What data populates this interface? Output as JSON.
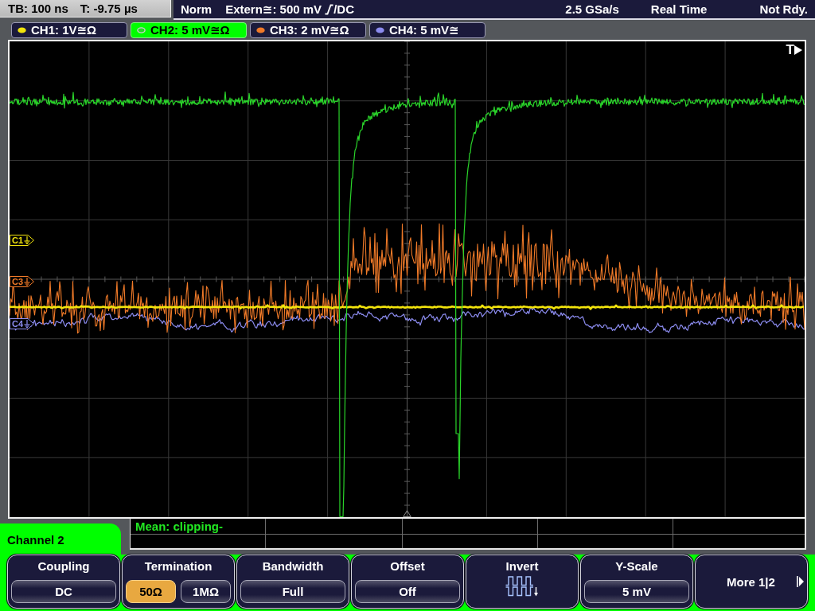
{
  "status_bar": {
    "timebase": "TB: 100 ns",
    "trigger_time": "T: -9.75 µs",
    "trigger_mode": "Norm",
    "trigger_source": "Extern≅: 500 mV",
    "trigger_coupling": "/DC",
    "sample_rate": "2.5 GSa/s",
    "acquisition": "Real Time",
    "status": "Not Rdy."
  },
  "channels": [
    {
      "label": "CH1: 1V≅Ω",
      "selected": false,
      "color": "#f2e40c",
      "marker": "C1"
    },
    {
      "label": "CH2: 5 mV≅Ω",
      "selected": true,
      "color": "#2ad42a"
    },
    {
      "label": "CH3: 2 mV≅Ω",
      "selected": false,
      "color": "#f07a28",
      "marker": "C3"
    },
    {
      "label": "CH4: 5 mV≅",
      "selected": false,
      "color": "#8c8cf0",
      "marker": "C4"
    }
  ],
  "display": {
    "trigger_marker": "T"
  },
  "measurement": {
    "result": "Mean: clipping-"
  },
  "menu": {
    "title": "Channel 2",
    "softkeys": [
      {
        "kind": "value",
        "label": "Coupling",
        "value": "DC"
      },
      {
        "kind": "choice",
        "label": "Termination",
        "options": [
          {
            "text": "50Ω",
            "selected": true
          },
          {
            "text": "1MΩ",
            "selected": false
          }
        ]
      },
      {
        "kind": "value",
        "label": "Bandwidth",
        "value": "Full"
      },
      {
        "kind": "value",
        "label": "Offset",
        "value": "Off"
      },
      {
        "kind": "icon",
        "label": "Invert"
      },
      {
        "kind": "value",
        "label": "Y-Scale",
        "value": "5 mV"
      },
      {
        "kind": "more",
        "label": "More 1|2"
      }
    ]
  }
}
